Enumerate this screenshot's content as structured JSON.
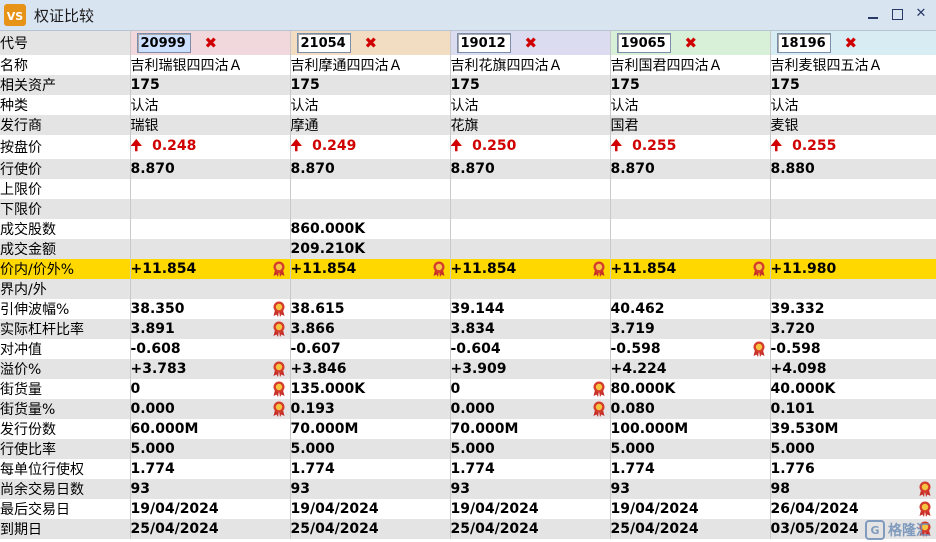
{
  "window": {
    "title": "权证比较",
    "app_icon_text": "VS"
  },
  "labels": {
    "code": "代号",
    "name": "名称",
    "underlying": "相关资产",
    "type": "种类",
    "issuer": "发行商",
    "price": "按盘价",
    "strike": "行使价",
    "upper": "上限价",
    "lower": "下限价",
    "volume": "成交股数",
    "turnover": "成交金额",
    "moneyness": "价内/价外%",
    "in_out": "界内/外",
    "iv": "引伸波幅%",
    "eff_gearing": "实际杠杆比率",
    "delta": "对冲值",
    "premium": "溢价%",
    "outstanding": "街货量",
    "outstanding_pct": "街货量%",
    "issue_size": "发行份数",
    "conv_ratio": "行使比率",
    "exercise_per_unit": "每单位行使权",
    "days_left": "尚余交易日数",
    "last_trade": "最后交易日",
    "expiry": "到期日"
  },
  "warrants": [
    {
      "code": "20999",
      "name": "吉利瑞银四四沽Ａ",
      "underlying": "175",
      "type": "认沽",
      "issuer": "瑞银",
      "price": "0.248",
      "strike": "8.870",
      "upper": "",
      "lower": "",
      "volume": "",
      "turnover": "",
      "moneyness": "+11.854",
      "in_out": "",
      "iv": "38.350",
      "eff_gearing": "3.891",
      "delta": "-0.608",
      "premium": "+3.783",
      "outstanding": "0",
      "outstanding_pct": "0.000",
      "issue_size": "60.000M",
      "conv_ratio": "5.000",
      "exercise_per_unit": "1.774",
      "days_left": "93",
      "last_trade": "19/04/2024",
      "expiry": "25/04/2024"
    },
    {
      "code": "21054",
      "name": "吉利摩通四四沽Ａ",
      "underlying": "175",
      "type": "认沽",
      "issuer": "摩通",
      "price": "0.249",
      "strike": "8.870",
      "upper": "",
      "lower": "",
      "volume": "860.000K",
      "turnover": "209.210K",
      "moneyness": "+11.854",
      "in_out": "",
      "iv": "38.615",
      "eff_gearing": "3.866",
      "delta": "-0.607",
      "premium": "+3.846",
      "outstanding": "135.000K",
      "outstanding_pct": "0.193",
      "issue_size": "70.000M",
      "conv_ratio": "5.000",
      "exercise_per_unit": "1.774",
      "days_left": "93",
      "last_trade": "19/04/2024",
      "expiry": "25/04/2024"
    },
    {
      "code": "19012",
      "name": "吉利花旗四四沽Ａ",
      "underlying": "175",
      "type": "认沽",
      "issuer": "花旗",
      "price": "0.250",
      "strike": "8.870",
      "upper": "",
      "lower": "",
      "volume": "",
      "turnover": "",
      "moneyness": "+11.854",
      "in_out": "",
      "iv": "39.144",
      "eff_gearing": "3.834",
      "delta": "-0.604",
      "premium": "+3.909",
      "outstanding": "0",
      "outstanding_pct": "0.000",
      "issue_size": "70.000M",
      "conv_ratio": "5.000",
      "exercise_per_unit": "1.774",
      "days_left": "93",
      "last_trade": "19/04/2024",
      "expiry": "25/04/2024"
    },
    {
      "code": "19065",
      "name": "吉利国君四四沽Ａ",
      "underlying": "175",
      "type": "认沽",
      "issuer": "国君",
      "price": "0.255",
      "strike": "8.870",
      "upper": "",
      "lower": "",
      "volume": "",
      "turnover": "",
      "moneyness": "+11.854",
      "in_out": "",
      "iv": "40.462",
      "eff_gearing": "3.719",
      "delta": "-0.598",
      "premium": "+4.224",
      "outstanding": "80.000K",
      "outstanding_pct": "0.080",
      "issue_size": "100.000M",
      "conv_ratio": "5.000",
      "exercise_per_unit": "1.774",
      "days_left": "93",
      "last_trade": "19/04/2024",
      "expiry": "25/04/2024"
    },
    {
      "code": "18196",
      "name": "吉利麦银四五沽Ａ",
      "underlying": "175",
      "type": "认沽",
      "issuer": "麦银",
      "price": "0.255",
      "strike": "8.880",
      "upper": "",
      "lower": "",
      "volume": "",
      "turnover": "",
      "moneyness": "+11.980",
      "in_out": "",
      "iv": "39.332",
      "eff_gearing": "3.720",
      "delta": "-0.598",
      "premium": "+4.098",
      "outstanding": "40.000K",
      "outstanding_pct": "0.101",
      "issue_size": "39.530M",
      "conv_ratio": "5.000",
      "exercise_per_unit": "1.776",
      "days_left": "98",
      "last_trade": "26/04/2024",
      "expiry": "03/05/2024"
    }
  ],
  "up_arrow": "🠉",
  "close_symbol": "✖",
  "watermark": {
    "logo": "G",
    "text": "格隆汇"
  },
  "colors": {
    "highlight": "#ffd800",
    "price_up": "#d10000",
    "row_alt": "#e4e4e4"
  }
}
